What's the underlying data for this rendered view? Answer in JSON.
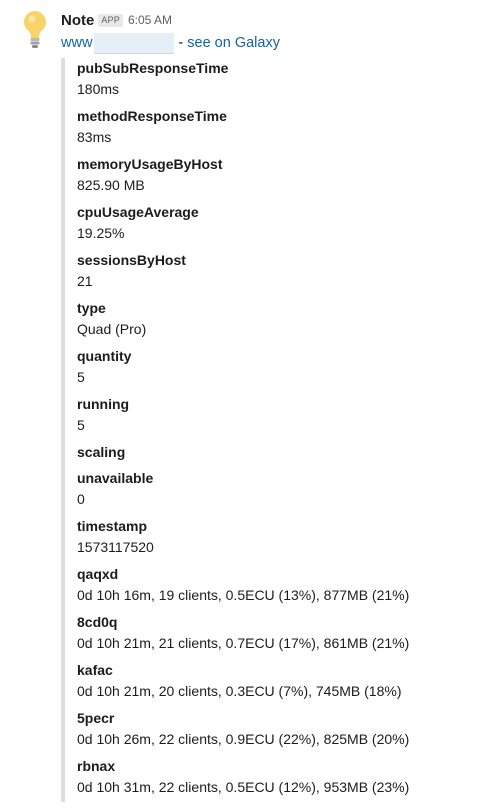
{
  "message": {
    "sender": "Note",
    "badge": "APP",
    "time": "6:05 AM",
    "link_prefix": "www",
    "separator": "-",
    "link_text": "see on Galaxy",
    "avatar_icon": "lightbulb-icon"
  },
  "fields": [
    {
      "title": "pubSubResponseTime",
      "value": "180ms"
    },
    {
      "title": "methodResponseTime",
      "value": "83ms"
    },
    {
      "title": "memoryUsageByHost",
      "value": "825.90 MB"
    },
    {
      "title": "cpuUsageAverage",
      "value": "19.25%"
    },
    {
      "title": "sessionsByHost",
      "value": "21"
    },
    {
      "title": "type",
      "value": "Quad (Pro)"
    },
    {
      "title": "quantity",
      "value": "5"
    },
    {
      "title": "running",
      "value": "5"
    },
    {
      "title": "scaling",
      "value": ""
    },
    {
      "title": "unavailable",
      "value": "0"
    },
    {
      "title": "timestamp",
      "value": "1573117520"
    },
    {
      "title": "qaqxd",
      "value": "0d 10h 16m, 19 clients, 0.5ECU (13%), 877MB (21%)"
    },
    {
      "title": "8cd0q",
      "value": "0d 10h 21m, 21 clients, 0.7ECU (17%), 861MB (21%)"
    },
    {
      "title": "kafac",
      "value": "0d 10h 21m, 20 clients, 0.3ECU (7%), 745MB (18%)"
    },
    {
      "title": "5pecr",
      "value": "0d 10h 26m, 22 clients, 0.9ECU (22%), 825MB (20%)"
    },
    {
      "title": "rbnax",
      "value": "0d 10h 31m, 22 clients, 0.5ECU (12%), 953MB (23%)"
    }
  ],
  "colors": {
    "link": "#1264a3",
    "attachment_border": "#dddddd",
    "text": "#1d1c1d",
    "muted": "#616061",
    "bulb": "#f7d468"
  }
}
